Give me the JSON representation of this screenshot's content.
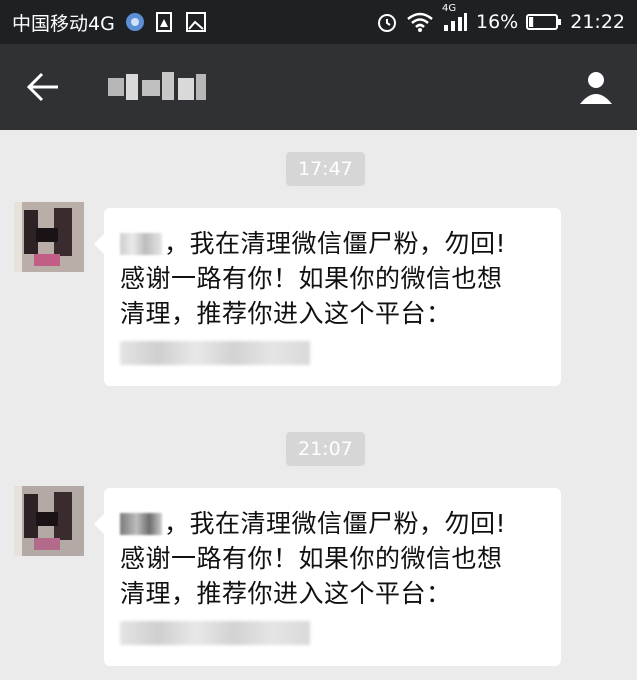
{
  "status_bar": {
    "carrier": "中国移动4G",
    "network_badge": "4G",
    "battery_percent": "16%",
    "time": "21:22",
    "battery_level": 0.16,
    "icons": [
      "cloud-badge-icon",
      "photo-alert-icon",
      "gallery-icon",
      "alarm-icon",
      "wifi-icon",
      "signal-icon",
      "battery-icon"
    ]
  },
  "header": {
    "back_icon": "back-arrow-icon",
    "profile_icon": "person-icon"
  },
  "messages": [
    {
      "time": "17:47",
      "text_line1": "，我在清理微信僵尸粉，勿回!",
      "text_line2": "感谢一路有你！如果你的微信也想",
      "text_line3": "清理，推荐你进入这个平台："
    },
    {
      "time": "21:07",
      "text_line1": "，我在清理微信僵尸粉，勿回!",
      "text_line2": "感谢一路有你！如果你的微信也想",
      "text_line3": "清理，推荐你进入这个平台："
    }
  ],
  "colors": {
    "status_bar_bg": "#1e2124",
    "app_bar_bg": "#2f3134",
    "chat_bg": "#ebebeb",
    "bubble_bg": "#ffffff",
    "time_chip_bg": "#d6d6d6"
  }
}
